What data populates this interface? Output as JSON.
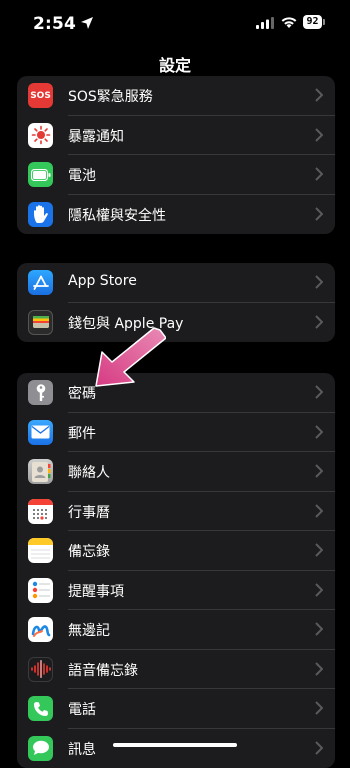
{
  "status_bar": {
    "time": "2:54",
    "battery": "92"
  },
  "header": {
    "title": "設定"
  },
  "group1": {
    "items": [
      {
        "label": "SOS緊急服務",
        "icon": "sos-icon",
        "icon_text": "SOS",
        "color": "#e53935"
      },
      {
        "label": "暴露通知",
        "icon": "exposure-notification-icon",
        "color": "#ffffff"
      },
      {
        "label": "電池",
        "icon": "battery-icon",
        "color": "#34c759"
      },
      {
        "label": "隱私權與安全性",
        "icon": "privacy-hand-icon",
        "color": "#1a73e8"
      }
    ]
  },
  "group2": {
    "items": [
      {
        "label": "App Store",
        "icon": "app-store-icon",
        "color": "#1e88e5"
      },
      {
        "label": "錢包與 Apple Pay",
        "icon": "wallet-icon",
        "color": "#2b2b2b"
      }
    ]
  },
  "group3": {
    "items": [
      {
        "label": "密碼",
        "icon": "key-icon",
        "color": "#8e8e93"
      },
      {
        "label": "郵件",
        "icon": "mail-icon",
        "color": "#1e88e5"
      },
      {
        "label": "聯絡人",
        "icon": "contacts-icon",
        "color": "#9e9e9e"
      },
      {
        "label": "行事曆",
        "icon": "calendar-icon",
        "color": "#ffffff"
      },
      {
        "label": "備忘錄",
        "icon": "notes-icon",
        "color": "#ffffff"
      },
      {
        "label": "提醒事項",
        "icon": "reminders-icon",
        "color": "#ffffff"
      },
      {
        "label": "無邊記",
        "icon": "freeform-icon",
        "color": "#ffffff"
      },
      {
        "label": "語音備忘錄",
        "icon": "voice-memos-icon",
        "color": "#1c1c1e"
      },
      {
        "label": "電話",
        "icon": "phone-icon",
        "color": "#34c759"
      },
      {
        "label": "訊息",
        "icon": "messages-icon",
        "color": "#34c759"
      }
    ]
  },
  "annotation": {
    "arrow_color": "#e0508f"
  }
}
